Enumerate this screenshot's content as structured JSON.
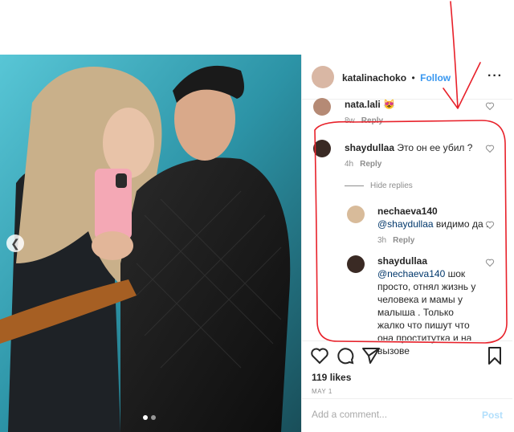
{
  "post": {
    "author": "katalinachoko",
    "separator": "•",
    "follow_label": "Follow",
    "more_label": "···",
    "likes": "119 likes",
    "date": "MAY 1",
    "add_comment_placeholder": "Add a comment...",
    "post_label": "Post",
    "carousel": {
      "slides": 2,
      "active_slide": 1
    }
  },
  "comments": [
    {
      "username": "nata.lali",
      "text": "😻",
      "time": "8w",
      "reply_label": "Reply"
    },
    {
      "username": "shaydullaa",
      "text": "Это он ее убил ?",
      "time": "4h",
      "reply_label": "Reply"
    }
  ],
  "hide_replies_label": "Hide replies",
  "replies": [
    {
      "username": "nechaeva140",
      "mention": "@shaydullaa",
      "text": " видимо да .",
      "time": "3h",
      "reply_label": "Reply"
    },
    {
      "username": "shaydullaa",
      "mention": "@nechaeva140",
      "text": " шок просто, отнял жизнь у человека и мамы у малыша . Только жалко что пишут что она проститутка и на вызове"
    }
  ],
  "colors": {
    "accent": "#3897f0",
    "annotation": "#e8212a",
    "text": "#262626",
    "muted": "#8e8e8e"
  },
  "icons": [
    "chevron-left-icon",
    "more-icon",
    "heart-icon",
    "comment-icon",
    "share-icon",
    "bookmark-icon"
  ]
}
